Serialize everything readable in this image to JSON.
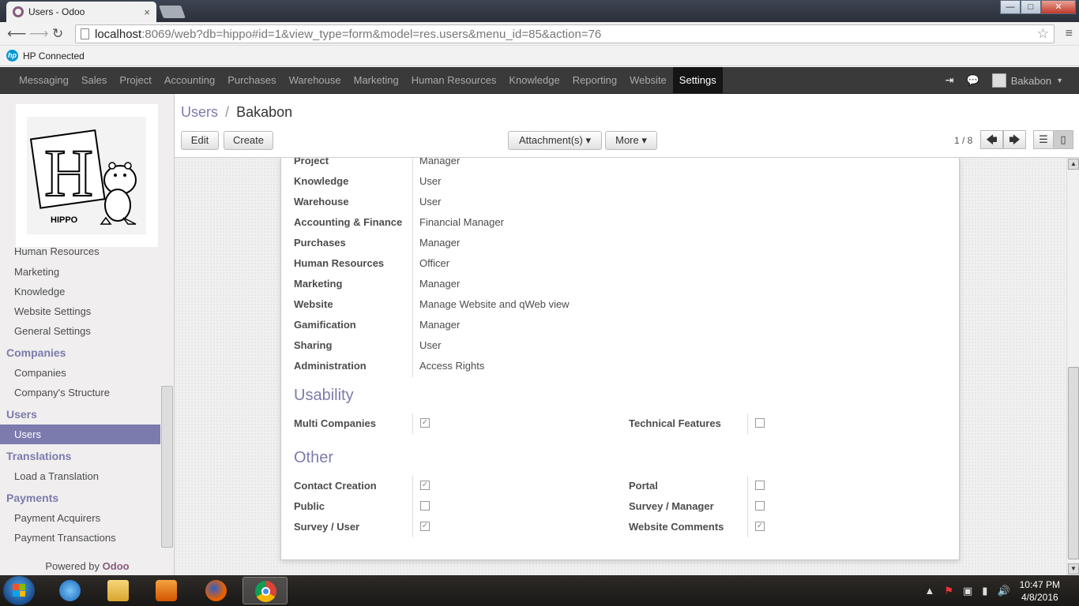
{
  "browser": {
    "tab_title": "Users - Odoo",
    "tab_close": "×",
    "url_host": "localhost",
    "url_rest": ":8069/web?db=hippo#id=1&view_type=form&model=res.users&menu_id=85&action=76",
    "bookmark": "HP Connected",
    "window_controls": [
      "—",
      "□",
      "✕"
    ]
  },
  "topmenu": {
    "items": [
      "Messaging",
      "Sales",
      "Project",
      "Accounting",
      "Purchases",
      "Warehouse",
      "Marketing",
      "Human Resources",
      "Knowledge",
      "Reporting",
      "Website",
      "Settings"
    ],
    "active": "Settings",
    "user": "Bakabon"
  },
  "logo": {
    "text": "HIPPO",
    "letter": "H"
  },
  "sidebar": {
    "items": [
      {
        "type": "item",
        "label": "Human Resources"
      },
      {
        "type": "item",
        "label": "Marketing"
      },
      {
        "type": "item",
        "label": "Knowledge"
      },
      {
        "type": "item",
        "label": "Website Settings"
      },
      {
        "type": "item",
        "label": "General Settings"
      },
      {
        "type": "head",
        "label": "Companies"
      },
      {
        "type": "item",
        "label": "Companies"
      },
      {
        "type": "item",
        "label": "Company's Structure"
      },
      {
        "type": "head",
        "label": "Users"
      },
      {
        "type": "item",
        "label": "Users",
        "active": true
      },
      {
        "type": "head",
        "label": "Translations"
      },
      {
        "type": "item",
        "label": "Load a Translation"
      },
      {
        "type": "head",
        "label": "Payments"
      },
      {
        "type": "item",
        "label": "Payment Acquirers"
      },
      {
        "type": "item",
        "label": "Payment Transactions"
      }
    ],
    "powered_prefix": "Powered by ",
    "powered_brand": "Odoo"
  },
  "header": {
    "breadcrumb_parent": "Users",
    "breadcrumb_sep": "/",
    "breadcrumb_current": "Bakabon",
    "edit_label": "Edit",
    "create_label": "Create",
    "attachments_label": "Attachment(s) ▾",
    "more_label": "More ▾",
    "pager": "1 / 8"
  },
  "access_rights": [
    {
      "app": "Project",
      "level": "Manager"
    },
    {
      "app": "Knowledge",
      "level": "User"
    },
    {
      "app": "Warehouse",
      "level": "User"
    },
    {
      "app": "Accounting & Finance",
      "level": "Financial Manager"
    },
    {
      "app": "Purchases",
      "level": "Manager"
    },
    {
      "app": "Human Resources",
      "level": "Officer"
    },
    {
      "app": "Marketing",
      "level": "Manager"
    },
    {
      "app": "Website",
      "level": "Manage Website and qWeb view"
    },
    {
      "app": "Gamification",
      "level": "Manager"
    },
    {
      "app": "Sharing",
      "level": "User"
    },
    {
      "app": "Administration",
      "level": "Access Rights"
    }
  ],
  "usability": {
    "title": "Usability",
    "fields": [
      {
        "label": "Multi Companies",
        "checked": true
      },
      {
        "label": "Technical Features",
        "checked": false
      }
    ]
  },
  "other": {
    "title": "Other",
    "fields": [
      {
        "label": "Contact Creation",
        "checked": true
      },
      {
        "label": "Portal",
        "checked": false
      },
      {
        "label": "Public",
        "checked": false
      },
      {
        "label": "Survey / Manager",
        "checked": false
      },
      {
        "label": "Survey / User",
        "checked": true
      },
      {
        "label": "Website Comments",
        "checked": true
      }
    ]
  },
  "taskbar": {
    "time": "10:47 PM",
    "date": "4/8/2016"
  }
}
